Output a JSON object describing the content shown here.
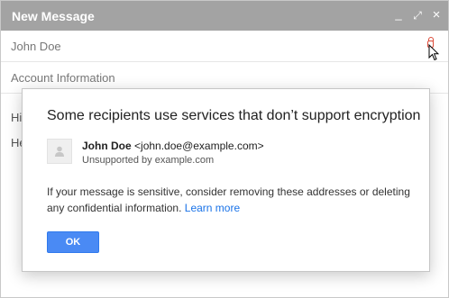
{
  "window": {
    "title": "New Message",
    "controls": {
      "minimize_symbol": "_",
      "maximize_symbol": "⤢",
      "close_symbol": "×"
    }
  },
  "compose": {
    "to": "John Doe",
    "subject": "Account Information",
    "body_line1": "Hi",
    "body_line2": "He"
  },
  "dialog": {
    "title": "Some recipients use services that don’t support encryption",
    "recipient": {
      "name": "John Doe",
      "email": "<john.doe@example.com>",
      "status": "Unsupported by example.com"
    },
    "message": "If your message is sensitive, consider removing these addresses or deleting any confidential information.",
    "learn_more": "Learn more",
    "ok_label": "OK"
  },
  "colors": {
    "titlebar": "#a3a3a3",
    "primary_button": "#4a8af4",
    "link": "#1a73e8",
    "warning_icon": "#dd4b39"
  }
}
